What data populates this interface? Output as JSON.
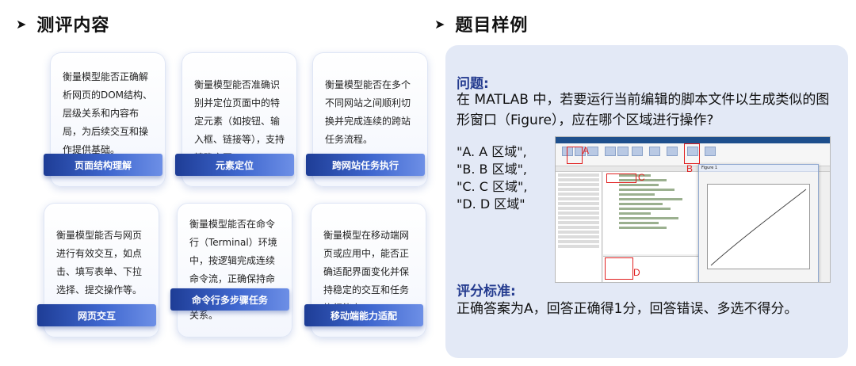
{
  "left_section": {
    "title": "测评内容",
    "cards": [
      {
        "text": "衡量模型能否正确解析网页的DOM结构、层级关系和内容布局，为后续交互和操作提供基础。",
        "tag": "页面结构理解"
      },
      {
        "text": "衡量模型能否准确识别并定位页面中的特定元素（如按钮、输入框、链接等），支持精确交互。",
        "tag": "元素定位"
      },
      {
        "text": "衡量模型能否在多个不同网站之间顺利切换并完成连续的跨站任务流程。",
        "tag": "跨网站任务执行"
      },
      {
        "text": "衡量模型能否与网页进行有效交互，如点击、填写表单、下拉选择、提交操作等。",
        "tag": "网页交互"
      },
      {
        "text": "衡量模型能否在命令行（Terminal）环境中，按逻辑完成连续命令流，正确保持命令上下文，处理依赖关系。",
        "tag": "命令行多步骤任务"
      },
      {
        "text": "衡量模型在移动端网页或应用中，能否正确适配界面变化并保持稳定的交互和任务执行能力。",
        "tag": "移动端能力适配"
      }
    ]
  },
  "right_section": {
    "title": "题目样例",
    "question_label": "问题:",
    "question_text": "在 MATLAB 中，若要运行当前编辑的脚本文件以生成类似的图形窗口（Figure），应在哪个区域进行操作?",
    "options": [
      "\"A. A 区域\",",
      "\"B. B 区域\",",
      "\"C. C 区域\",",
      "\"D. D 区域\""
    ],
    "markers": [
      "A",
      "B",
      "C",
      "D"
    ],
    "figure_title": "Figure 1",
    "score_label": "评分标准:",
    "score_text": "正确答案为A，回答正确得1分，回答错误、多选不得分。"
  },
  "colors": {
    "accent": "#243b8f",
    "tag_start": "#1e3d96",
    "tag_end": "#6d8fe6",
    "panel": "#e3e9f6",
    "marker": "#e02020"
  }
}
